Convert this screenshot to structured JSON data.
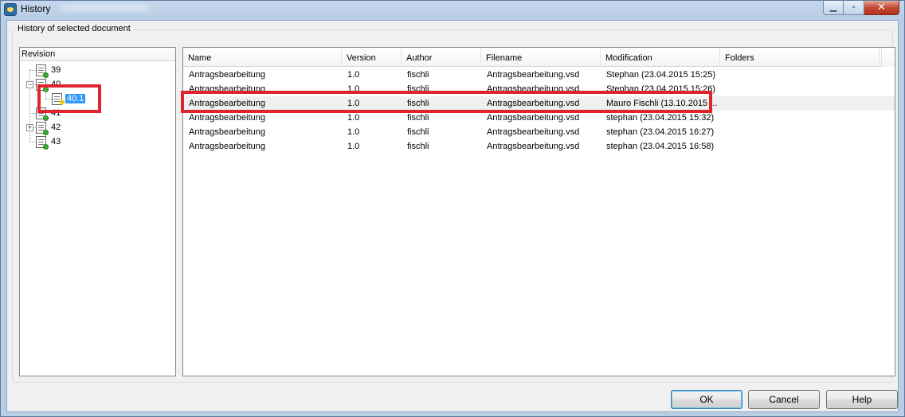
{
  "window": {
    "title": "History",
    "colors": {
      "callout": "#e0242d",
      "selection": "#3399ff",
      "title_gradient": "#c5d7ec"
    }
  },
  "group": {
    "label": "History of selected document"
  },
  "tree": {
    "header": "Revision",
    "nodes": [
      {
        "label": "39",
        "level": 0,
        "expander": "",
        "icon": "document-ok-icon"
      },
      {
        "label": "40",
        "level": 0,
        "expander": "−",
        "icon": "document-ok-icon"
      },
      {
        "label": "40.1",
        "level": 1,
        "expander": "",
        "icon": "document-new-icon",
        "selected": true
      },
      {
        "label": "41",
        "level": 0,
        "expander": "",
        "icon": "document-ok-icon"
      },
      {
        "label": "42",
        "level": 0,
        "expander": "+",
        "icon": "document-ok-icon"
      },
      {
        "label": "43",
        "level": 0,
        "expander": "",
        "icon": "document-ok-icon"
      }
    ]
  },
  "list": {
    "columns": [
      "Name",
      "Version",
      "Author",
      "Filename",
      "Modification",
      "Folders"
    ],
    "rows": [
      [
        "Antragsbearbeitung",
        "1.0",
        "fischli",
        "Antragsbearbeitung.vsd",
        "Stephan (23.04.2015 15:25)",
        ""
      ],
      [
        "Antragsbearbeitung",
        "1.0",
        "fischli",
        "Antragsbearbeitung.vsd",
        "Stephan (23.04.2015 15:26)",
        ""
      ],
      [
        "Antragsbearbeitung",
        "1.0",
        "fischli",
        "Antragsbearbeitung.vsd",
        "Mauro Fischli (13.10.2015 ...",
        ""
      ],
      [
        "Antragsbearbeitung",
        "1.0",
        "fischli",
        "Antragsbearbeitung.vsd",
        "stephan (23.04.2015 15:32)",
        ""
      ],
      [
        "Antragsbearbeitung",
        "1.0",
        "fischli",
        "Antragsbearbeitung.vsd",
        "stephan (23.04.2015 16:27)",
        ""
      ],
      [
        "Antragsbearbeitung",
        "1.0",
        "fischli",
        "Antragsbearbeitung.vsd",
        "stephan (23.04.2015 16:58)",
        ""
      ]
    ],
    "highlighted_row": 2
  },
  "buttons": {
    "ok": "OK",
    "cancel": "Cancel",
    "help": "Help"
  }
}
